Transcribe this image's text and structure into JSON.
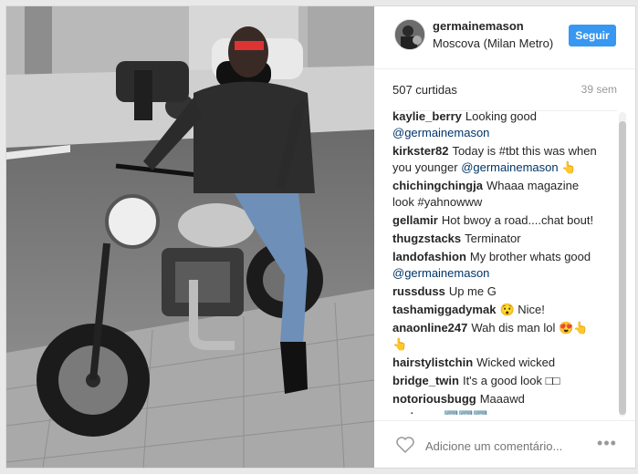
{
  "post": {
    "username": "germainemason",
    "location": "Moscova (Milan Metro)",
    "follow_label": "Seguir",
    "likes": "507 curtidas",
    "age": "39 sem"
  },
  "comments": [
    {
      "user": "kaylie_berry",
      "text": "Looking good",
      "mention": "@germainemason"
    },
    {
      "user": "kirkster82",
      "text": "Today is #tbt this was when you younger",
      "mention": "@germainemason",
      "suffix": "👆"
    },
    {
      "user": "chichingchingja",
      "text": "Whaaa magazine look #yahnowww",
      "mention": ""
    },
    {
      "user": "gellamir",
      "text": "Hot bwoy a road....chat bout!",
      "mention": ""
    },
    {
      "user": "thugzstacks",
      "text": "Terminator",
      "mention": ""
    },
    {
      "user": "landofashion",
      "text": "My brother whats good",
      "mention": "@germainemason"
    },
    {
      "user": "russduss",
      "text": "Up me G",
      "mention": ""
    },
    {
      "user": "tashamiggadymak",
      "text": "😯 Nice!",
      "mention": ""
    },
    {
      "user": "anaonline247",
      "text": "Wah dis man lol 😍👆👆",
      "mention": ""
    },
    {
      "user": "hairstylistchin",
      "text": "Wicked wicked",
      "mention": ""
    },
    {
      "user": "bridge_twin",
      "text": "It's a good look □□",
      "mention": ""
    },
    {
      "user": "notoriousbugg",
      "text": "Maaawd",
      "mention": ""
    },
    {
      "user": "rasisses",
      "text": "🆙🆙🆙",
      "mention": ""
    }
  ],
  "footer": {
    "comment_placeholder": "Adicione um comentário...",
    "more_label": "•••"
  },
  "colors": {
    "accent": "#3897f0",
    "mention": "#003569",
    "text": "#262626",
    "muted": "#999999"
  },
  "icons": {
    "like": "heart-icon",
    "more": "more-options-icon"
  }
}
